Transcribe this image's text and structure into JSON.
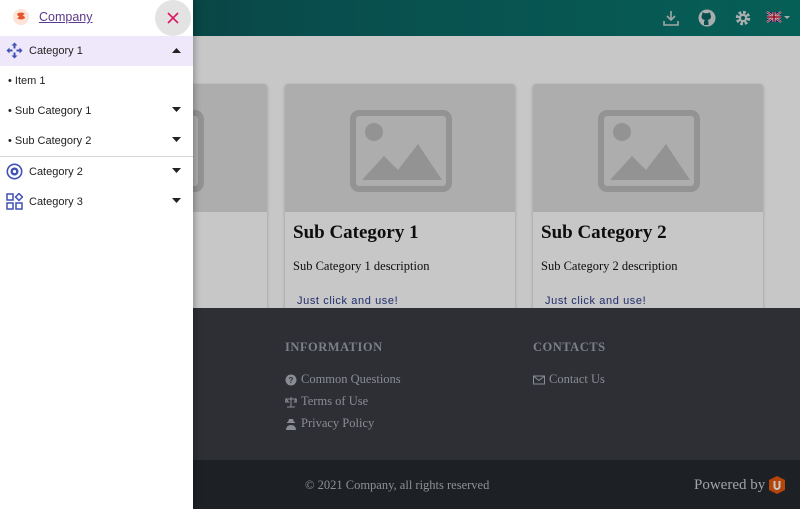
{
  "drawer": {
    "company": "Company",
    "menu": [
      {
        "label": "Category 1",
        "icon": "arrows-move-icon",
        "level": 0,
        "expanded": true
      },
      {
        "label": "• Item 1",
        "level": 1
      },
      {
        "label": "• Sub Category 1",
        "level": 1,
        "expandable": true
      },
      {
        "label": "• Sub Category 2",
        "level": 1,
        "expandable": true
      },
      {
        "label": "Category 2",
        "icon": "target-icon",
        "level": 0,
        "expandable": true
      },
      {
        "label": "Category 3",
        "icon": "widgets-icon",
        "level": 0,
        "expandable": true
      }
    ]
  },
  "cards": [
    {
      "title": "Sub Category 1",
      "description": "Sub Category 1 description",
      "link": "Just click and use!"
    },
    {
      "title": "Sub Category 2",
      "description": "Sub Category 2 description",
      "link": "Just click and use!"
    }
  ],
  "footer": {
    "information": {
      "heading": "INFORMATION",
      "links": [
        "Common Questions",
        "Terms of Use",
        "Privacy Policy"
      ]
    },
    "contacts": {
      "heading": "CONTACTS",
      "links": [
        "Contact Us"
      ]
    }
  },
  "bottom": {
    "copyright": "© 2021 Company, all rights reserved",
    "powered": "Powered by"
  },
  "colors": {
    "accent": "#3f51b5",
    "topbar": "#087a70",
    "footer": "#3a3d44",
    "drawer_active": "#efe8fa"
  }
}
